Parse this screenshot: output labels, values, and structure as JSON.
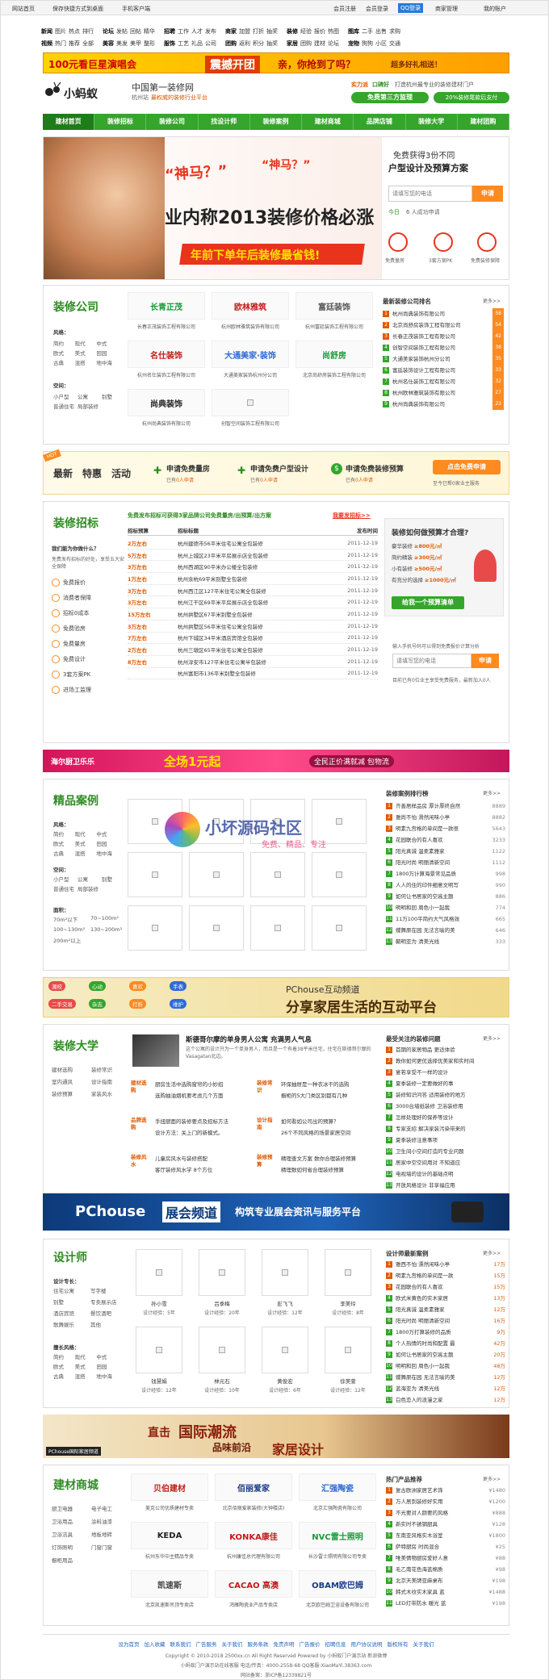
{
  "topbar": {
    "left": [
      "网站首页",
      "保存快捷方式到桌面",
      "手机客户端"
    ],
    "right": [
      "会员注册",
      "会员登录",
      "QQ登录",
      "商家管理",
      "我的账户"
    ]
  },
  "nav_rows": [
    [
      "新闻",
      "图片",
      "热点",
      "排行",
      "论坛",
      "发帖",
      "回帖",
      "精华",
      "招聘",
      "工作",
      "人才",
      "发布",
      "商家",
      "加盟",
      "打折",
      "抽奖",
      "装修",
      "经验",
      "报价",
      "热图",
      "图库",
      "二手",
      "出售",
      "求购"
    ],
    [
      "视频",
      "热门",
      "推荐",
      "全部",
      "美容",
      "美发",
      "美甲",
      "整形",
      "服饰",
      "工艺",
      "礼品",
      "公司",
      "团购",
      "返利",
      "积分",
      "抽奖",
      "家居",
      "团购",
      "建材",
      "论坛",
      "宠物",
      "狗狗",
      "小区",
      "交通"
    ]
  ],
  "banner1": {
    "left": "100元看巨星演唱会",
    "mid": "震撼开团",
    "text": "亲，你抢到了吗？",
    "right": "超多好礼相送！"
  },
  "logo": {
    "name": "小蚂蚁",
    "slogan": "中国第一装修网",
    "sub": "杭州站",
    "sub2": "最权威的装修行业平台",
    "strength": "实力派",
    "strength_text": "口碑好",
    "strength_text2": "打造杭州最专业的装修建材门户",
    "btn1": "免费第三方监理",
    "btn2": "20%装修尾款后支付"
  },
  "mainnav": [
    "建材首页",
    "装修招标",
    "装修公司",
    "找设计师",
    "装修案例",
    "建材商城",
    "品牌店铺",
    "装修大学",
    "建材团购"
  ],
  "hero": {
    "quote1": "“神马？”",
    "quote2": "“神马？”",
    "headline": "业内称2013装修价格必涨",
    "sub": "年前下单年后装修最省钱!",
    "form_title": "免费获得3份不同",
    "form_title2": "户型设计及预算方案",
    "placeholder": "请填写您的电话",
    "apply": "申请",
    "today": "今日",
    "count": "6 人成功申请",
    "icons": [
      "免费量房",
      "3套方案PK",
      "免费装修保障"
    ]
  },
  "companies": {
    "title": "装修公司",
    "more": "更多>>",
    "filter_label1": "风格：",
    "filters1": [
      "简约",
      "现代",
      "中式",
      "欧式",
      "美式",
      "田园",
      "古典",
      "混搭",
      "地中海"
    ],
    "filter_label2": "空间：",
    "filters2": [
      "小户型",
      "公寓",
      "别墅",
      "普通住宅",
      "局部装修"
    ],
    "logos": [
      {
        "mark": "长青正茂",
        "cap": "长春正茂装饰工程有限公司"
      },
      {
        "mark": "欧林雅筑",
        "cap": "杭州欧林雅筑装饰有限公司"
      },
      {
        "mark": "富廷装饰",
        "cap": "杭州富廷装饰工程有限公司"
      },
      {
        "mark": "名仕装饰",
        "cap": "杭州名仕装饰工程有限公司"
      },
      {
        "mark": "大通美家·装饰",
        "cap": "大通美家装饰杭州分公司"
      },
      {
        "mark": "尚舒房",
        "cap": "北京尚舒房装饰工程有限公司"
      },
      {
        "mark": "尚典装饰",
        "cap": "杭州尚典装饰有限公司"
      },
      {
        "mark": "",
        "cap": "创智空间装饰工程有限公司"
      }
    ],
    "rank_title": "最新装修公司排名",
    "rank": [
      {
        "name": "杭州尚典装饰有限公司",
        "score": "58"
      },
      {
        "name": "北京尚舒房装饰工程有限公司",
        "score": "54"
      },
      {
        "name": "长春正茂装饰工程有限公司",
        "score": "42"
      },
      {
        "name": "创智空间装饰工程有限公司",
        "score": "38"
      },
      {
        "name": "大通美家装饰杭州分公司",
        "score": "35"
      },
      {
        "name": "富廷装饰设计工程有限公司",
        "score": "33"
      },
      {
        "name": "杭州名仕装饰工程有限公司",
        "score": "32"
      },
      {
        "name": "杭州欧林雅筑装饰有限公司",
        "score": "27"
      },
      {
        "name": "杭州尚典装饰有限公司",
        "score": "23"
      }
    ]
  },
  "strip": {
    "hot": "HOT",
    "t1": "最新",
    "t2": "特惠",
    "t3": "活动",
    "a1": "申请免费量房",
    "a1s": "已有",
    "a1n": "0人申请",
    "a2": "申请免费户型设计",
    "a2s": "已有",
    "a2n": "0人申请",
    "a3": "申请免费装修预算",
    "a3s": "已有",
    "a3n": "0人申请",
    "btn": "点击免费申请",
    "btnsub": "至今已帮0家业主服务"
  },
  "bid": {
    "title": "装修招标",
    "intro": "免费发布招标可获得3家品牌公司免费量房/出预算/出方案",
    "link": "我要发招标>>",
    "cols": [
      "招标预算",
      "招标标题",
      "发布时间"
    ],
    "rows": [
      [
        "2万左右",
        "杭州建德市56平米住宅公寓全包装修",
        "2011-12-19"
      ],
      [
        "5万左右",
        "杭州上城区23平米平房展示店全包装修",
        "2011-12-19"
      ],
      [
        "3万左右",
        "杭州西湖区90平米办公楼全包装修",
        "2011-12-19"
      ],
      [
        "1万左右",
        "杭州余杭69平米别墅全包装修",
        "2011-12-19"
      ],
      [
        "3万左右",
        "杭州西江区127平米住宅公寓全包装修",
        "2011-12-19"
      ],
      [
        "3万左右",
        "杭州江干区69平米平房展示店全包装修",
        "2011-12-19"
      ],
      [
        "15万左右",
        "杭州拱墅区67平米别墅全包装修",
        "2011-12-19"
      ],
      [
        "3万左右",
        "杭州拱墅区56平米住宅公寓全包装修",
        "2011-12-19"
      ],
      [
        "7万左右",
        "杭州下城区34平米酒店宾馆全包装修",
        "2011-12-19"
      ],
      [
        "2万左右",
        "杭州三墩区65平米住宅公寓全包装修",
        "2011-12-19"
      ],
      [
        "8万左右",
        "杭州淳安市127平米住宅公寓半包装修",
        "2011-12-19"
      ],
      [
        "",
        "杭州富阳市136平米别墅全包装修",
        "2011-12-19"
      ]
    ],
    "why": "免费发布招标的好处，享受五大安全保障",
    "why_label": "我们能为你做什么？",
    "items": [
      "免费报价",
      "消费者保障",
      "招标0成本",
      "免费验房",
      "免费量房",
      "免费设计",
      "3套方案PK",
      "进场工监理"
    ],
    "calc_title": "装修如何做预算才合理?",
    "calc": [
      [
        "豪华装修",
        "≥800元/㎡"
      ],
      [
        "简约精装",
        "≥300元/㎡"
      ],
      [
        "小有装修",
        "≥500元/㎡"
      ],
      [
        "有充分的选择",
        "≥1000元/㎡"
      ]
    ],
    "calc_btn": "给我一个预算清单",
    "phone_tip": "输入手机号码可以得到免费报价计算分析",
    "phone_placeholder": "请填写您的电话",
    "phone_btn": "申请",
    "phone_note": "目前已有0位业主享受免费服务，最新加入0人"
  },
  "banner2": {
    "left": "海尔厨卫乐乐",
    "mid": "全场1元起",
    "right": "全民正价满就减 包物流"
  },
  "cases": {
    "title": "精品案例",
    "more": "更多>>",
    "labels": [
      "风格：",
      "空间：",
      "面积："
    ],
    "f1": [
      "简约",
      "现代",
      "中式",
      "欧式",
      "美式",
      "田园",
      "古典",
      "混搭",
      "地中海"
    ],
    "f2": [
      "小户型",
      "公寓",
      "别墅",
      "普通住宅",
      "局部装修"
    ],
    "f3": [
      "70m²以下",
      "70~100m²",
      "100~130m²",
      "130~200m²",
      "200m²以上"
    ],
    "rank_title": "装修案例排行榜",
    "rank": [
      [
        "齐善居样品房 厚计厚终自然",
        "8889"
      ],
      [
        "雅尚不怕 滑然闲味小亭",
        "8882"
      ],
      [
        "明素九宫格的单间是一款很",
        "5643"
      ],
      [
        "花园联合的有人喜欢",
        "3233"
      ],
      [
        "阳光真诚 温柔素雅家",
        "1122"
      ],
      [
        "阳光时尚 明丽清新空间",
        "1112"
      ],
      [
        "1800万计算海景常见品质",
        "998"
      ],
      [
        "人人的住的印件细意文明写",
        "990"
      ],
      [
        "如何让书居家的空高主题",
        "886"
      ],
      [
        "明明和回 周色小一起我",
        "774"
      ],
      [
        "11万100平简约大气风格效",
        "665"
      ],
      [
        "蝶舞原在园 无法言喻的美",
        "646"
      ],
      [
        "朝明亚为 清美光线",
        "333"
      ]
    ]
  },
  "watermark": {
    "title": "小坏源码社区",
    "sub": "免费、精品、专注"
  },
  "banner3": {
    "title": "PChouse互动频道",
    "sub": "分享家居生活的互动平台",
    "items": [
      "潮校",
      "心动",
      "喜欢",
      "手表",
      "二手交易",
      "杂志",
      "打折",
      "维护"
    ]
  },
  "uni": {
    "title": "装修大学",
    "more": "更多>>",
    "cats": [
      "建材选购",
      "装修常识",
      "室内通风",
      "设计指南",
      "装修预算",
      "家装风水"
    ],
    "headline": "斯德哥尔摩的单身男人公寓 充满男人气息",
    "desc": "这个公寓的设计只为一个单身男人，而且是一个有着38平米住宅，住宅在斯德哥尔摩的Vasagatan北边。",
    "blocks": [
      {
        "tag": "建材选购",
        "lines": [
          "厨房生活中选购窗帘的小妙招",
          "选购抽油烟机要考虑几个方面"
        ]
      },
      {
        "tag": "装修常识",
        "lines": [
          "环保抽屉是一种衣冰干的选购",
          "橱柜的5大门类区别都有几种"
        ]
      },
      {
        "tag": "品牌选购",
        "lines": [
          "手扭厨面的装修要点及招标方法",
          "设计方法：关上门的新模式。"
        ]
      },
      {
        "tag": "设计指南",
        "lines": [
          "如何看如公司出的预算？",
          "26个不同风格的场景家居空间"
        ]
      },
      {
        "tag": "装修风水",
        "lines": [
          "儿童房风水与装修搭配",
          "客厅装修风水学 8个方位"
        ]
      },
      {
        "tag": "装修预算",
        "lines": [
          "精理查文方案 数你合理装修预算",
          "精理数如何省合理装修预算"
        ]
      }
    ],
    "rank_title": "最受关注的装修问题",
    "rank": [
      "首期的家居物品 更适体验",
      "教你如何更优选择优美家和实时间",
      "宴若享受不一样的设计",
      "夏季装修一定要做好的事",
      "装修知识问答 适用装修的地方",
      "3000台墙纸装修 卫浴装修用",
      "怎样处理好的保养等设计",
      "专家支招 解决家装污染带来的",
      "夏季装修注意事项",
      "卫生间小空间打造的专业问题",
      "居家中空空间用对 不知道应",
      "电视墙的设计的基础点明",
      "开放风格设计 非享福应用",
      "2011家装五大流行趋势"
    ]
  },
  "banner4": {
    "title": "PChouse",
    "tag": "展会频道",
    "sub": "构筑专业展会资讯与服务平台"
  },
  "designer": {
    "title": "设计师",
    "more": "更多>>",
    "lbl1": "设计专长：",
    "spec": [
      "住宅公寓",
      "写字楼",
      "别墅",
      "专卖展示店",
      "酒店宾馆",
      "餐饮酒吧",
      "歌舞娱乐",
      "其他"
    ],
    "lbl2": "擅长风格：",
    "styles": [
      "简约",
      "现代",
      "中式",
      "欧式",
      "美式",
      "田园",
      "古典",
      "混搭",
      "地中海"
    ],
    "people": [
      [
        "孙小雪",
        "设计经验：5年"
      ],
      [
        "吕季梅",
        "设计经验：20年"
      ],
      [
        "彭飞飞",
        "设计经验：12年"
      ],
      [
        "李美玲",
        "设计经验：8年"
      ],
      [
        "钱慧娟",
        "设计经验：12年"
      ],
      [
        "林元石",
        "设计经验：10年"
      ],
      [
        "黄俊宏",
        "设计经验：6年"
      ],
      [
        "徐美萱",
        "设计经验：12年"
      ]
    ],
    "rank_title": "设计师最新案例",
    "rank": [
      [
        "雅西不怕 漂然闲味小亭",
        "17万"
      ],
      [
        "明素九宫格的单间是一款",
        "15万"
      ],
      [
        "花园联合的有人喜欢",
        "15万"
      ],
      [
        "欧式米黄色的实木家居",
        "13万"
      ],
      [
        "阳光真诚 温柔素雅家",
        "12万"
      ],
      [
        "阳光时尚 明丽清新空间",
        "16万"
      ],
      [
        "1800万打算装修的品质",
        "9万"
      ],
      [
        "个人热情的时尚和配置 最",
        "42万"
      ],
      [
        "如何让书居家的空高主题",
        "20万"
      ],
      [
        "明明和回 周色小一起我",
        "48万"
      ],
      [
        "蝶舞原在园 无法言喻的美",
        "12万"
      ],
      [
        "蓝海亚为 清美光线",
        "12万"
      ],
      [
        "白色恋人的浪漫之家",
        "12万"
      ]
    ]
  },
  "banner5": {
    "left": "直击",
    "mid": "国际潮流",
    "sub": "品味前沿",
    "right": "家居设计",
    "tag": "PChouse国际家居频道"
  },
  "mall": {
    "title": "建材商城",
    "more": "更多>>",
    "cats": [
      "厨卫电器",
      "电子电工",
      "卫浴用品",
      "涂料油漆",
      "卫浴洁具",
      "地板地砖",
      "灯饰照明",
      "门窗门窗",
      "橱柜用品"
    ],
    "logos": [
      {
        "mark": "贝伯建材",
        "cap": "美克公司优质建材专卖"
      },
      {
        "mark": "佰丽爱家",
        "cap": "北京佰丽爱家装修(大钟楼店)"
      },
      {
        "mark": "汇强陶瓷",
        "cap": "北京汇强陶瓷有限公司"
      },
      {
        "mark": "KEDA",
        "cap": "杭州东华中主精品专卖"
      },
      {
        "mark": "KONKA康佳",
        "cap": "杭州康佳总代理有限公司"
      },
      {
        "mark": "NVC雷士照明",
        "cap": "长沙雷士照明有限公司专卖"
      },
      {
        "mark": "凯速斯",
        "cap": "北京凯速斯吊顶专卖店"
      },
      {
        "mark": "CACAO 高澳",
        "cap": "鸿雁陶瓷业产品专卖店"
      },
      {
        "mark": "OBAM欧巴姆",
        "cap": "北京欧巴姆卫浴设备有限公司"
      }
    ],
    "rank_title": "热门产品推荐",
    "rank": [
      [
        "复古欧洲家居艺术饰",
        "¥1480"
      ],
      [
        "万人居到装修好实用",
        "¥1200"
      ],
      [
        "不光要对人颜要的风格",
        "¥888"
      ],
      [
        "新实时不锈钢厨具",
        "¥128"
      ],
      [
        "东南亚风格实木浴室",
        "¥1800"
      ],
      [
        "萨特厨房 时尚混合",
        "¥25"
      ],
      [
        "唯美情物厨房爱好人意",
        "¥88"
      ],
      [
        "毛乙南花色海蓝棉质",
        "¥98"
      ],
      [
        "北京天美牌亚麻桌布",
        "¥198"
      ],
      [
        "韩式木纹实木家具 蓝",
        "¥1488"
      ],
      [
        "LED灯带防水 暖光 蓝",
        "¥198"
      ]
    ]
  },
  "footer": {
    "links": [
      "设为首页",
      "加入收藏",
      "联系我们",
      "广告服务",
      "关于我们",
      "服务条款",
      "免责声明",
      "广告报价",
      "招聘信息",
      "用户协议说明",
      "版权所有",
      "关于我们"
    ],
    "copy": "Copyright © 2010-2018 2500xx.cn All Right Reserved Powered by 小蚂蚁门户演示站 新浪微博",
    "contact": "小蚂蚁门户演示站在线客服 电话/传真：4000-2558-68 QQ客服:XiaoMaYi.38363.com",
    "icp": "网站备案：浙ICP备12339821号"
  }
}
